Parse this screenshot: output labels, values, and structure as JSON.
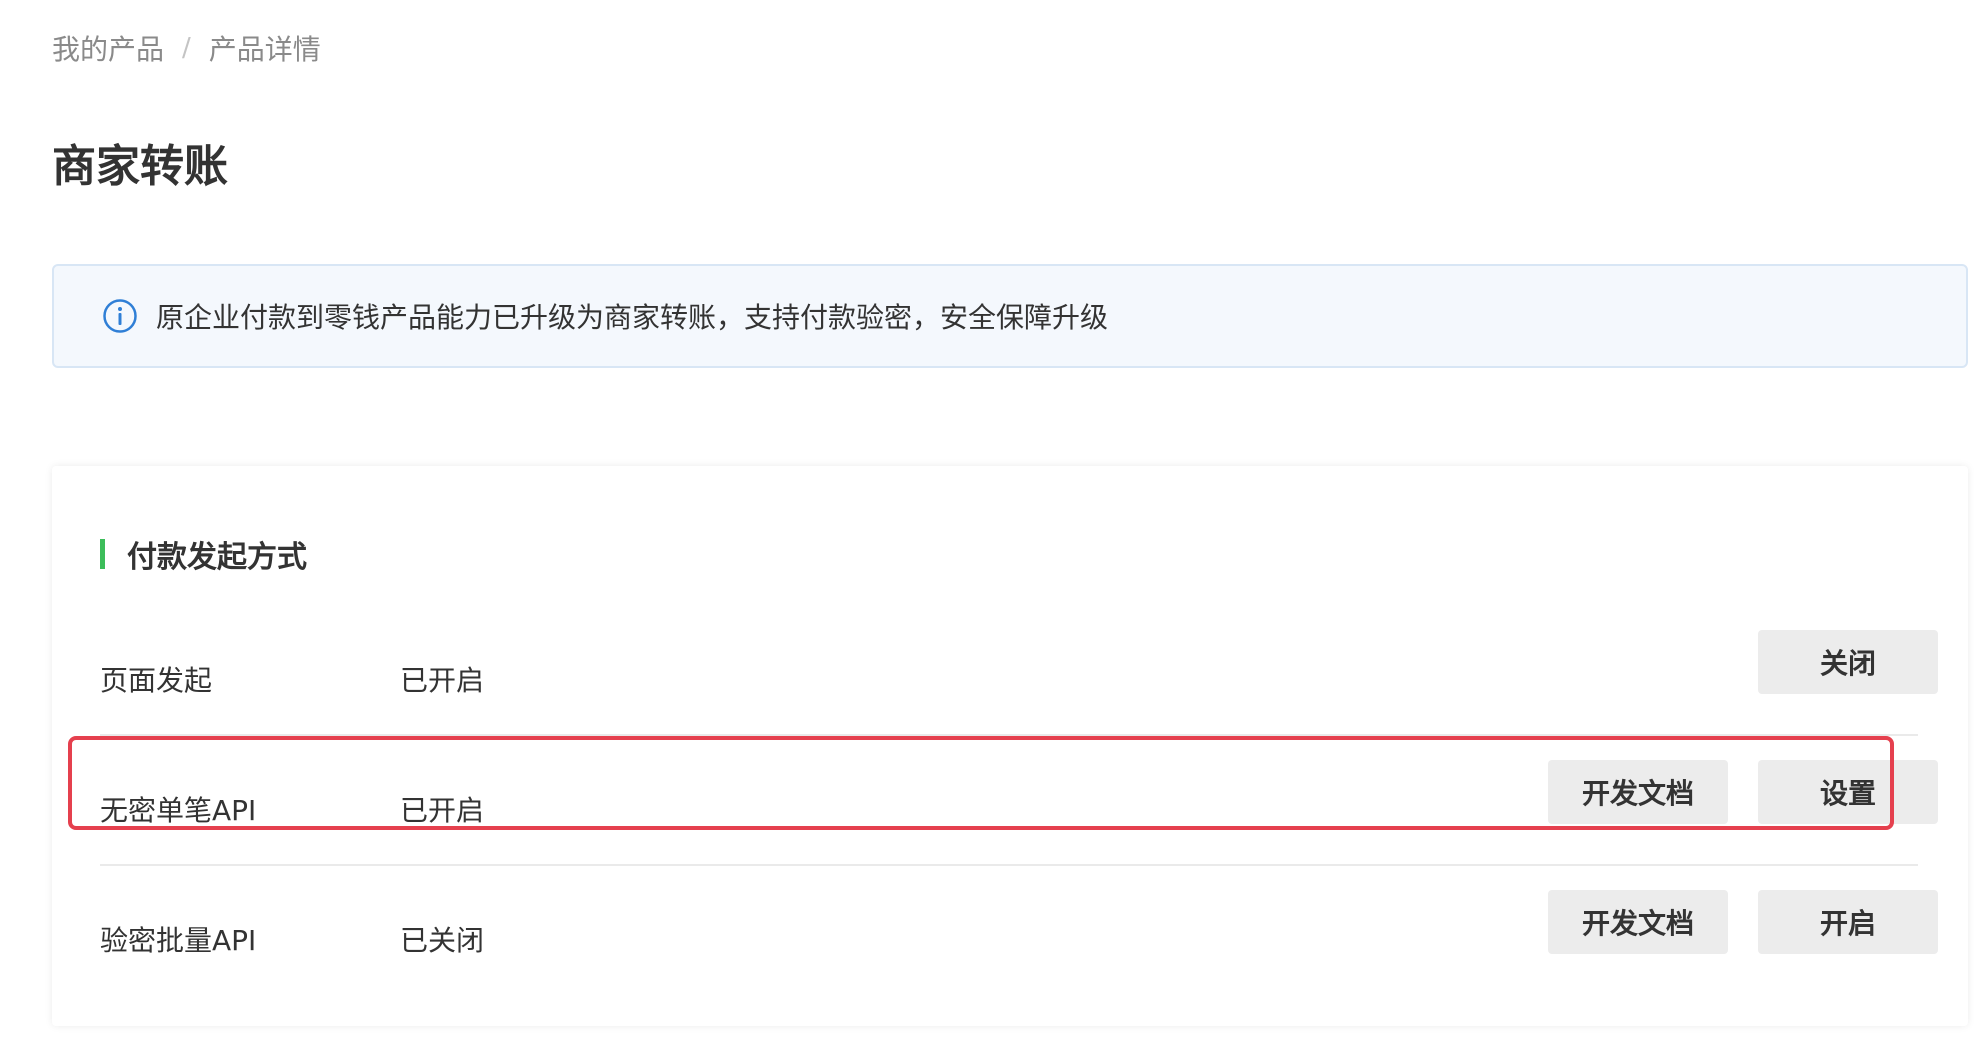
{
  "breadcrumb": {
    "items": [
      "我的产品",
      "产品详情"
    ],
    "separator": "/"
  },
  "page": {
    "title": "商家转账"
  },
  "notice": {
    "icon": "info-icon",
    "text": "原企业付款到零钱产品能力已升级为商家转账，支持付款验密，安全保障升级"
  },
  "section": {
    "title": "付款发起方式",
    "accent_color": "#3cbd5a",
    "rows": [
      {
        "name": "页面发起",
        "status": "已开启",
        "primary_button": "关闭"
      },
      {
        "name": "无密单笔API",
        "status": "已开启",
        "secondary_button": "开发文档",
        "primary_button": "设置",
        "highlighted": true
      },
      {
        "name": "验密批量API",
        "status": "已关闭",
        "secondary_button": "开发文档",
        "primary_button": "开启"
      }
    ]
  },
  "colors": {
    "highlight_border": "#e5404e",
    "notice_background": "#f4f8fd",
    "info_icon": "#2f7fd6",
    "button_background": "#ececec"
  }
}
